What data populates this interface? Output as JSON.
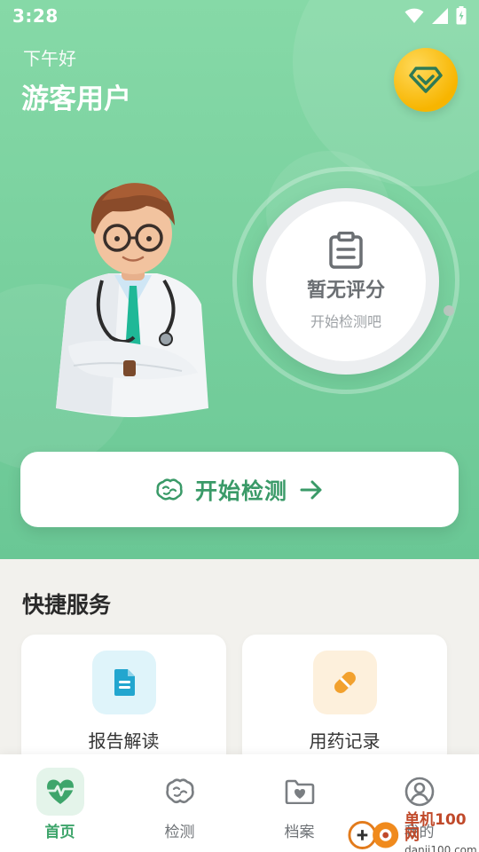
{
  "status_bar": {
    "time": "3:28"
  },
  "header": {
    "greeting": "下午好",
    "username": "游客用户"
  },
  "score": {
    "title": "暂无评分",
    "subtitle": "开始检测吧"
  },
  "start_button": {
    "label": "开始检测"
  },
  "quick_services": {
    "title": "快捷服务",
    "items": [
      {
        "label": "报告解读",
        "icon": "document-icon"
      },
      {
        "label": "用药记录",
        "icon": "pill-icon"
      }
    ]
  },
  "bottom_nav": {
    "items": [
      {
        "label": "首页",
        "icon": "heartbeat-icon",
        "active": true
      },
      {
        "label": "检测",
        "icon": "brain-icon",
        "active": false
      },
      {
        "label": "档案",
        "icon": "folder-heart-icon",
        "active": false
      },
      {
        "label": "我的",
        "icon": "user-icon",
        "active": false
      }
    ]
  },
  "watermark": {
    "name": "单机100网",
    "url": "danji100.com"
  },
  "colors": {
    "accent": "#3ea56b",
    "hero_green": "#7ad19f",
    "vip_gold": "#f7b500"
  }
}
